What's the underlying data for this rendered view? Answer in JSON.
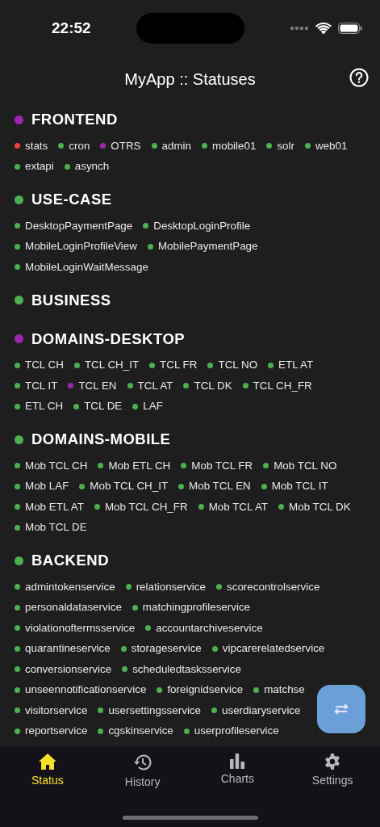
{
  "status_bar": {
    "time": "22:52"
  },
  "header": {
    "title": "MyApp :: Statuses"
  },
  "sections": [
    {
      "title": "FRONTEND",
      "color": "#9c27b0",
      "rows": [
        [
          {
            "name": "stats",
            "color": "#f44336"
          },
          {
            "name": "cron",
            "color": "#4caf50"
          },
          {
            "name": "OTRS",
            "color": "#9c27b0"
          },
          {
            "name": "admin",
            "color": "#4caf50"
          },
          {
            "name": "mobile01",
            "color": "#4caf50"
          },
          {
            "name": "solr",
            "color": "#4caf50"
          },
          {
            "name": "web01",
            "color": "#4caf50"
          }
        ],
        [
          {
            "name": "extapi",
            "color": "#4caf50"
          },
          {
            "name": "asynch",
            "color": "#4caf50"
          }
        ]
      ]
    },
    {
      "title": "USE-CASE",
      "color": "#4caf50",
      "rows": [
        [
          {
            "name": "DesktopPaymentPage",
            "color": "#4caf50"
          },
          {
            "name": "DesktopLoginProfile",
            "color": "#4caf50"
          }
        ],
        [
          {
            "name": "MobileLoginProfileView",
            "color": "#4caf50"
          },
          {
            "name": "MobilePaymentPage",
            "color": "#4caf50"
          }
        ],
        [
          {
            "name": "MobileLoginWaitMessage",
            "color": "#4caf50"
          }
        ]
      ]
    },
    {
      "title": "BUSINESS",
      "color": "#4caf50"
    },
    {
      "title": "DOMAINS-DESKTOP",
      "color": "#9c27b0",
      "rows": [
        [
          {
            "name": "TCL CH",
            "color": "#4caf50"
          },
          {
            "name": "TCL CH_IT",
            "color": "#4caf50"
          },
          {
            "name": "TCL FR",
            "color": "#4caf50"
          },
          {
            "name": "TCL NO",
            "color": "#4caf50"
          },
          {
            "name": "ETL AT",
            "color": "#4caf50"
          }
        ],
        [
          {
            "name": "TCL IT",
            "color": "#4caf50"
          },
          {
            "name": "TCL EN",
            "color": "#9c27b0"
          },
          {
            "name": "TCL AT",
            "color": "#4caf50"
          },
          {
            "name": "TCL DK",
            "color": "#4caf50"
          },
          {
            "name": "TCL CH_FR",
            "color": "#4caf50"
          }
        ],
        [
          {
            "name": "ETL CH",
            "color": "#4caf50"
          },
          {
            "name": "TCL DE",
            "color": "#4caf50"
          },
          {
            "name": "LAF",
            "color": "#4caf50"
          }
        ]
      ]
    },
    {
      "title": "DOMAINS-MOBILE",
      "color": "#4caf50",
      "rows": [
        [
          {
            "name": "Mob TCL CH",
            "color": "#4caf50"
          },
          {
            "name": "Mob ETL CH",
            "color": "#4caf50"
          },
          {
            "name": "Mob TCL FR",
            "color": "#4caf50"
          },
          {
            "name": "Mob TCL NO",
            "color": "#4caf50"
          }
        ],
        [
          {
            "name": "Mob LAF",
            "color": "#4caf50"
          },
          {
            "name": "Mob TCL CH_IT",
            "color": "#4caf50"
          },
          {
            "name": "Mob TCL EN",
            "color": "#4caf50"
          },
          {
            "name": "Mob TCL IT",
            "color": "#4caf50"
          }
        ],
        [
          {
            "name": "Mob ETL AT",
            "color": "#4caf50"
          },
          {
            "name": "Mob TCL CH_FR",
            "color": "#4caf50"
          },
          {
            "name": "Mob TCL AT",
            "color": "#4caf50"
          },
          {
            "name": "Mob TCL DK",
            "color": "#4caf50"
          }
        ],
        [
          {
            "name": "Mob TCL DE",
            "color": "#4caf50"
          }
        ]
      ]
    },
    {
      "title": "BACKEND",
      "color": "#4caf50",
      "rows": [
        [
          {
            "name": "admintokenservice",
            "color": "#4caf50"
          },
          {
            "name": "relationservice",
            "color": "#4caf50"
          },
          {
            "name": "scorecontrolservice",
            "color": "#4caf50"
          }
        ],
        [
          {
            "name": "personaldataservice",
            "color": "#4caf50"
          },
          {
            "name": "matchingprofileservice",
            "color": "#4caf50"
          }
        ],
        [
          {
            "name": "violationoftermsservice",
            "color": "#4caf50"
          },
          {
            "name": "accountarchiveservice",
            "color": "#4caf50"
          }
        ],
        [
          {
            "name": "quarantineservice",
            "color": "#4caf50"
          },
          {
            "name": "storageservice",
            "color": "#4caf50"
          },
          {
            "name": "vipcarerelatedservice",
            "color": "#4caf50"
          }
        ],
        [
          {
            "name": "conversionservice",
            "color": "#4caf50"
          },
          {
            "name": "scheduledtasksservice",
            "color": "#4caf50"
          }
        ],
        [
          {
            "name": "unseennotificationservice",
            "color": "#4caf50"
          },
          {
            "name": "foreignidservice",
            "color": "#4caf50"
          },
          {
            "name": "matchse",
            "color": "#4caf50"
          }
        ],
        [
          {
            "name": "visitorservice",
            "color": "#4caf50"
          },
          {
            "name": "usersettingsservice",
            "color": "#4caf50"
          },
          {
            "name": "userdiaryservice",
            "color": "#4caf50"
          }
        ],
        [
          {
            "name": "reportservice",
            "color": "#4caf50"
          },
          {
            "name": "cgskinservice",
            "color": "#4caf50"
          },
          {
            "name": "userprofileservice",
            "color": "#4caf50"
          }
        ]
      ]
    }
  ],
  "tabs": [
    {
      "label": "Status",
      "kind": "home",
      "selected": true
    },
    {
      "label": "History",
      "kind": "history",
      "selected": false
    },
    {
      "label": "Charts",
      "kind": "chart",
      "selected": false
    },
    {
      "label": "Settings",
      "kind": "gear",
      "selected": false
    }
  ]
}
